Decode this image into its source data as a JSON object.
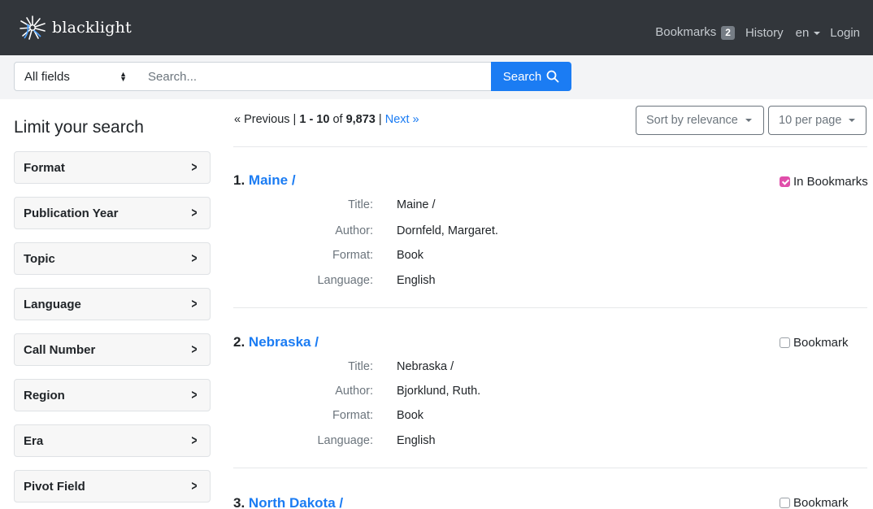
{
  "navbar": {
    "brand": "blacklight",
    "bookmarks_label": "Bookmarks",
    "bookmarks_count": "2",
    "history_label": "History",
    "language_label": "en",
    "login_label": "Login"
  },
  "search": {
    "field_selected": "All fields",
    "placeholder": "Search...",
    "button_label": "Search"
  },
  "sidebar": {
    "heading": "Limit your search",
    "facets": [
      {
        "label": "Format"
      },
      {
        "label": "Publication Year"
      },
      {
        "label": "Topic"
      },
      {
        "label": "Language"
      },
      {
        "label": "Call Number"
      },
      {
        "label": "Region"
      },
      {
        "label": "Era"
      },
      {
        "label": "Pivot Field"
      }
    ]
  },
  "results": {
    "pager": {
      "previous": "« Previous",
      "separator": "|",
      "range": "1 - 10",
      "of": "of",
      "total": "9,873",
      "next": "Next »"
    },
    "sort_label": "Sort by relevance",
    "per_page_label": "10 per page",
    "field_labels": {
      "title": "Title:",
      "author": "Author:",
      "format": "Format:",
      "language": "Language:"
    },
    "documents": [
      {
        "counter": "1.",
        "title_link": "Maine /",
        "bookmark_label": "In Bookmarks",
        "bookmarked": true,
        "title": "Maine /",
        "author": "Dornfeld, Margaret.",
        "format": "Book",
        "language": "English"
      },
      {
        "counter": "2.",
        "title_link": "Nebraska /",
        "bookmark_label": "Bookmark",
        "bookmarked": false,
        "title": "Nebraska /",
        "author": "Bjorklund, Ruth.",
        "format": "Book",
        "language": "English"
      },
      {
        "counter": "3.",
        "title_link": "North Dakota /",
        "bookmark_label": "Bookmark",
        "bookmarked": false
      }
    ]
  },
  "colors": {
    "navbar_bg": "#32363b",
    "accent_blue": "#1b7cf3",
    "bookmark_checked": "#e04eaa"
  }
}
